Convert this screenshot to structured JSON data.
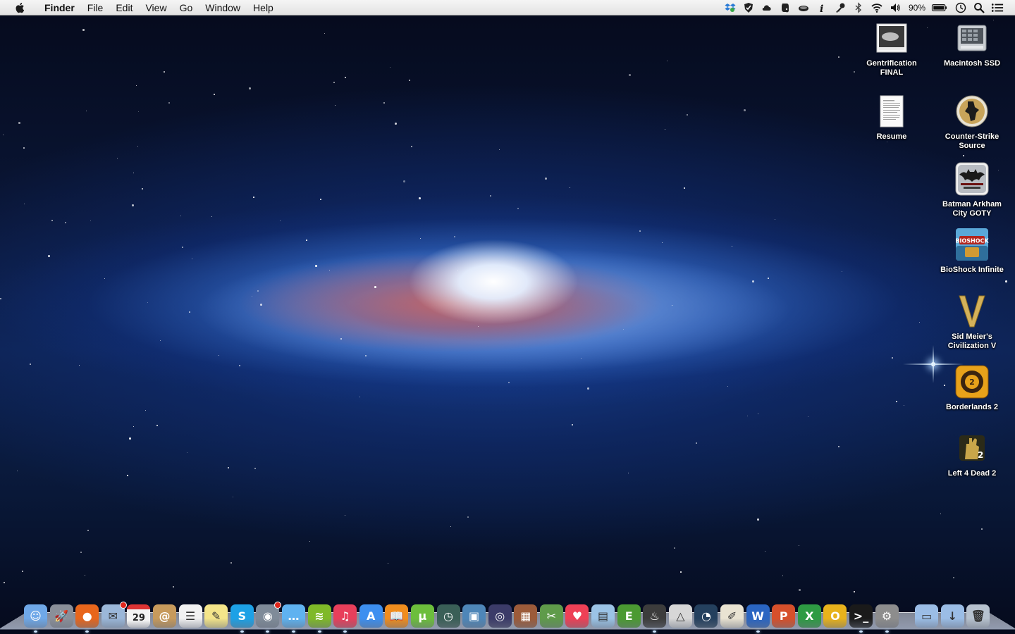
{
  "menubar": {
    "app_name": "Finder",
    "menus": [
      "File",
      "Edit",
      "View",
      "Go",
      "Window",
      "Help"
    ],
    "status_icons": [
      "dropbox-icon",
      "shield-icon",
      "cloud-icon",
      "evernote-icon",
      "caffeine-icon",
      "info-icon",
      "key-icon",
      "bluetooth-icon",
      "wifi-icon",
      "volume-icon"
    ],
    "battery_percent": "90%",
    "trailing_icons": [
      "time-machine-icon",
      "spotlight-search-icon",
      "notification-center-icon"
    ]
  },
  "desktop_icons": [
    {
      "label": "Gentrification FINAL",
      "icon": "document-image-icon"
    },
    {
      "label": "Macintosh SSD",
      "icon": "hard-drive-icon"
    },
    {
      "label": "Resume",
      "icon": "document-icon"
    },
    {
      "label": "Counter-Strike Source",
      "icon": "counter-strike-icon"
    },
    {
      "label": "Batman Arkham City GOTY",
      "icon": "batman-icon"
    },
    {
      "label": "BioShock Infinite",
      "icon": "bioshock-icon"
    },
    {
      "label": "Sid Meier's Civilization V",
      "icon": "civilization-icon"
    },
    {
      "label": "Borderlands 2",
      "icon": "borderlands-icon"
    },
    {
      "label": "Left 4 Dead 2",
      "icon": "left4dead-icon"
    }
  ],
  "calendar_day": "29",
  "dock": [
    {
      "name": "finder",
      "color": "#6fa8e8",
      "glyph": "☺"
    },
    {
      "name": "launchpad",
      "color": "#8a8f99",
      "glyph": "🚀"
    },
    {
      "name": "firefox",
      "color": "#e8661c",
      "glyph": "●"
    },
    {
      "name": "mail",
      "color": "#9bb7d9",
      "glyph": "✉"
    },
    {
      "name": "calendar",
      "color": "#f4f4f4",
      "glyph": ""
    },
    {
      "name": "contacts",
      "color": "#c79a5c",
      "glyph": "@"
    },
    {
      "name": "reminders",
      "color": "#f2f2f2",
      "glyph": "☰"
    },
    {
      "name": "notes",
      "color": "#f4e58a",
      "glyph": "✎"
    },
    {
      "name": "skype",
      "color": "#1da1e6",
      "glyph": "S"
    },
    {
      "name": "facetime",
      "color": "#7f8b99",
      "glyph": "◉"
    },
    {
      "name": "messages",
      "color": "#5fb2f0",
      "glyph": "…"
    },
    {
      "name": "spotify",
      "color": "#7fb928",
      "glyph": "≋"
    },
    {
      "name": "itunes",
      "color": "#e83f5b",
      "glyph": "♫"
    },
    {
      "name": "app-store",
      "color": "#3d8ff0",
      "glyph": "A"
    },
    {
      "name": "ibooks",
      "color": "#f08d1e",
      "glyph": "📖"
    },
    {
      "name": "utorrent",
      "color": "#6cbe3c",
      "glyph": "µ"
    },
    {
      "name": "time-machine",
      "color": "#3a5f57",
      "glyph": "◷"
    },
    {
      "name": "iphoto",
      "color": "#4e86b8",
      "glyph": "▣"
    },
    {
      "name": "aperture",
      "color": "#3b3b68",
      "glyph": "◎"
    },
    {
      "name": "photo-booth",
      "color": "#9c5b3a",
      "glyph": "▦"
    },
    {
      "name": "stickies",
      "color": "#5f9b4a",
      "glyph": "✂"
    },
    {
      "name": "pocket",
      "color": "#ee4056",
      "glyph": "♥"
    },
    {
      "name": "preview",
      "color": "#9bc3e6",
      "glyph": "▤"
    },
    {
      "name": "evernote",
      "color": "#4b9a32",
      "glyph": "E"
    },
    {
      "name": "steam",
      "color": "#3c3c3c",
      "glyph": "♨"
    },
    {
      "name": "cs-launcher",
      "color": "#d7d7d7",
      "glyph": "△"
    },
    {
      "name": "dashboard",
      "color": "#24405e",
      "glyph": "◔"
    },
    {
      "name": "textedit",
      "color": "#e9e3d2",
      "glyph": "✐"
    },
    {
      "name": "word",
      "color": "#2a65c2",
      "glyph": "W"
    },
    {
      "name": "powerpoint",
      "color": "#d6502b",
      "glyph": "P"
    },
    {
      "name": "excel",
      "color": "#2e9b43",
      "glyph": "X"
    },
    {
      "name": "outlook",
      "color": "#e8b21c",
      "glyph": "O"
    },
    {
      "name": "terminal",
      "color": "#1a1a1a",
      "glyph": ">_"
    },
    {
      "name": "system-preferences",
      "color": "#8d8d8d",
      "glyph": "⚙"
    },
    {
      "name": "documents-stack",
      "color": "#9bbde6",
      "glyph": "▭"
    },
    {
      "name": "downloads-stack",
      "color": "#9bbde6",
      "glyph": "↓"
    },
    {
      "name": "trash",
      "color": "#b7c2cf",
      "glyph": "🗑"
    }
  ]
}
